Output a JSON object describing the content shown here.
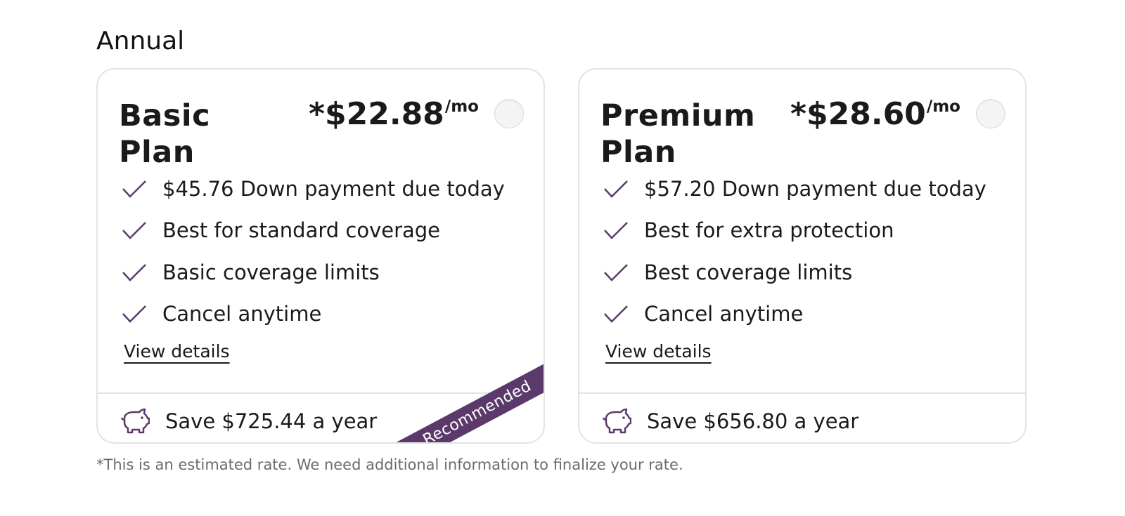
{
  "section_title": "Annual",
  "plans": [
    {
      "name": "Basic Plan",
      "price": "*$22.88",
      "price_unit": "/mo",
      "features": [
        "$45.76 Down payment due today",
        "Best for standard coverage",
        "Basic coverage limits",
        "Cancel anytime"
      ],
      "view_details": "View details",
      "savings": "Save $725.44 a year",
      "badge": "Recommended"
    },
    {
      "name": "Premium Plan",
      "price": "*$28.60",
      "price_unit": "/mo",
      "features": [
        "$57.20 Down payment due today",
        "Best for extra protection",
        "Best coverage limits",
        "Cancel anytime"
      ],
      "view_details": "View details",
      "savings": "Save $656.80 a year"
    }
  ],
  "footnote": "*This is an estimated rate. We need additional information to finalize your rate.",
  "icons": {
    "feature": "check-icon",
    "savings": "piggy-bank-icon"
  },
  "colors": {
    "accent": "#5b3a6b",
    "border": "#e3e3e3"
  }
}
